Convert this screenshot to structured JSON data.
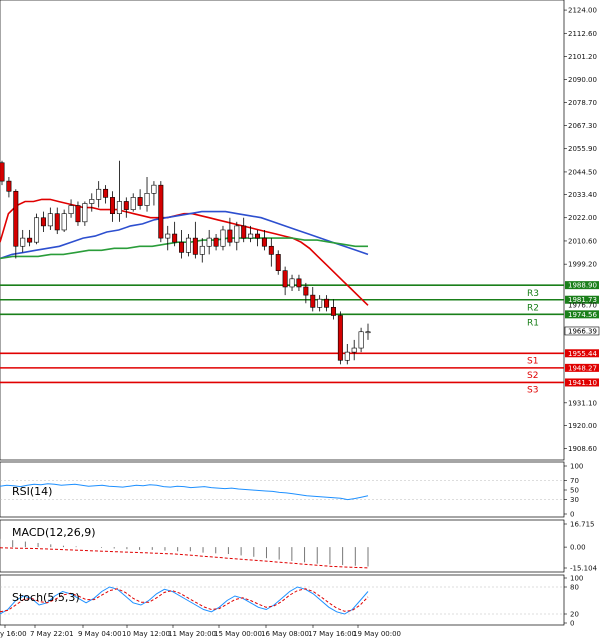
{
  "chart_data": {
    "type": "candlestick",
    "instrument_note": "",
    "price_axis": {
      "ylim": [
        1904.0,
        2126.0
      ],
      "ticks": [
        "2124.00",
        "2112.60",
        "2101.20",
        "2090.00",
        "2078.70",
        "2067.30",
        "2055.90",
        "2044.50",
        "2033.40",
        "2022.00",
        "2010.60",
        "1999.20",
        "1920.00",
        "1908.60",
        "1931.10"
      ],
      "tick_values": [
        2124.0,
        2112.6,
        2101.2,
        2090.0,
        2078.7,
        2067.3,
        2055.9,
        2044.5,
        2033.4,
        2022.0,
        2010.6,
        1999.2,
        1920.0,
        1908.6,
        1931.1
      ]
    },
    "x_labels": [
      "y 16:00",
      "7 May 22:01",
      "9 May 04:00",
      "10 May 12:00",
      "11 May 20:00",
      "15 May 00:00",
      "16 May 08:00",
      "17 May 16:00",
      "19 May 00:00"
    ],
    "candles": [
      [
        2049,
        2050,
        2038,
        2040
      ],
      [
        2040,
        2042,
        2032,
        2035
      ],
      [
        2035,
        2036,
        2002,
        2008
      ],
      [
        2008,
        2016,
        2005,
        2012
      ],
      [
        2012,
        2016,
        2008,
        2010
      ],
      [
        2010,
        2024,
        2009,
        2022
      ],
      [
        2022,
        2025,
        2015,
        2018
      ],
      [
        2018,
        2027,
        2016,
        2024
      ],
      [
        2024,
        2027,
        2014,
        2016
      ],
      [
        2016,
        2026,
        2015,
        2024
      ],
      [
        2024,
        2031,
        2022,
        2028
      ],
      [
        2028,
        2030,
        2018,
        2020
      ],
      [
        2020,
        2030,
        2018,
        2029
      ],
      [
        2029,
        2034,
        2025,
        2031
      ],
      [
        2031,
        2040,
        2027,
        2036
      ],
      [
        2036,
        2038,
        2029,
        2032
      ],
      [
        2032,
        2035,
        2020,
        2024
      ],
      [
        2024,
        2050,
        2020,
        2030
      ],
      [
        2030,
        2032,
        2022,
        2026
      ],
      [
        2026,
        2034,
        2025,
        2032
      ],
      [
        2032,
        2036,
        2026,
        2028
      ],
      [
        2028,
        2042,
        2025,
        2034
      ],
      [
        2034,
        2040,
        2028,
        2038
      ],
      [
        2038,
        2040,
        2010,
        2012
      ],
      [
        2012,
        2018,
        2006,
        2014
      ],
      [
        2014,
        2020,
        2008,
        2010
      ],
      [
        2010,
        2016,
        2002,
        2005
      ],
      [
        2005,
        2014,
        2003,
        2012
      ],
      [
        2012,
        2020,
        2002,
        2004
      ],
      [
        2004,
        2012,
        2000,
        2008
      ],
      [
        2008,
        2016,
        2004,
        2012
      ],
      [
        2012,
        2014,
        2006,
        2008
      ],
      [
        2008,
        2018,
        2006,
        2016
      ],
      [
        2016,
        2022,
        2008,
        2010
      ],
      [
        2010,
        2020,
        2006,
        2018
      ],
      [
        2018,
        2022,
        2010,
        2012
      ],
      [
        2012,
        2018,
        2010,
        2014
      ],
      [
        2014,
        2016,
        2008,
        2012
      ],
      [
        2012,
        2016,
        2006,
        2008
      ],
      [
        2008,
        2012,
        1998,
        2004
      ],
      [
        2004,
        2006,
        1994,
        1996
      ],
      [
        1996,
        1998,
        1984,
        1988
      ],
      [
        1988,
        1994,
        1986,
        1992
      ],
      [
        1992,
        1994,
        1986,
        1988
      ],
      [
        1988,
        1990,
        1980,
        1984
      ],
      [
        1984,
        1988,
        1976,
        1978
      ],
      [
        1978,
        1984,
        1976,
        1982
      ],
      [
        1982,
        1984,
        1976,
        1978
      ],
      [
        1978,
        1982,
        1972,
        1974
      ],
      [
        1974,
        1976,
        1950,
        1952
      ],
      [
        1952,
        1960,
        1950,
        1956
      ],
      [
        1956,
        1962,
        1952,
        1958
      ],
      [
        1958,
        1968,
        1956,
        1966
      ],
      [
        1966,
        1970,
        1962,
        1966
      ]
    ],
    "moving_averages": [
      {
        "color": "#e00000",
        "values": [
          2010,
          2024,
          2028,
          2030,
          2030,
          2031,
          2031,
          2030,
          2029,
          2028,
          2027,
          2027,
          2026,
          2026,
          2026,
          2025,
          2024,
          2023,
          2022,
          2022,
          2022,
          2023,
          2024,
          2024,
          2023,
          2022,
          2021,
          2020,
          2019,
          2018,
          2017,
          2016,
          2015,
          2014,
          2013,
          2012,
          2010,
          2007,
          2003,
          1999,
          1995,
          1991,
          1987,
          1983,
          1979
        ]
      },
      {
        "color": "#2d4fcf",
        "values": [
          2002,
          2004,
          2005,
          2006,
          2007,
          2008,
          2010,
          2012,
          2013,
          2015,
          2016,
          2018,
          2019,
          2021,
          2022,
          2023,
          2024,
          2025,
          2025,
          2025,
          2024,
          2023,
          2022,
          2020,
          2018,
          2016,
          2014,
          2012,
          2010,
          2008,
          2006,
          2004
        ]
      },
      {
        "color": "#2a9d3a",
        "values": [
          2002,
          2003,
          2003,
          2003,
          2004,
          2004,
          2005,
          2006,
          2006,
          2007,
          2007,
          2008,
          2008,
          2009,
          2010,
          2010,
          2011,
          2011,
          2012,
          2012,
          2012,
          2012,
          2012,
          2012,
          2011,
          2011,
          2010,
          2009,
          2008,
          2008
        ]
      }
    ],
    "levels": [
      {
        "name": "R3",
        "value": 1988.9,
        "label": "1988.90",
        "color": "#1a7f1a"
      },
      {
        "name": "R2",
        "value": 1981.73,
        "label": "1981.73",
        "color": "#1a7f1a"
      },
      {
        "name": "R1",
        "value": 1974.56,
        "label": "1974.56",
        "color": "#1a7f1a"
      },
      {
        "name": "S1",
        "value": 1955.44,
        "label": "1955.44",
        "color": "#e00000"
      },
      {
        "name": "S2",
        "value": 1948.27,
        "label": "1948.27",
        "color": "#e00000"
      },
      {
        "name": "S3",
        "value": 1941.1,
        "label": "1941.10",
        "color": "#e00000"
      }
    ],
    "current_price": {
      "value": 1966.39,
      "label": "1966.39"
    },
    "hidden_label": "1976.70",
    "rsi": {
      "title": "RSI(14)",
      "ticks": [
        "100",
        "70",
        "50",
        "30",
        "0"
      ],
      "tick_values": [
        100,
        70,
        50,
        30,
        0
      ],
      "color": "#1e90ff",
      "values": [
        58,
        60,
        59,
        57,
        60,
        62,
        61,
        63,
        62,
        60,
        61,
        62,
        60,
        58,
        59,
        60,
        58,
        57,
        56,
        58,
        60,
        59,
        61,
        60,
        57,
        56,
        58,
        57,
        55,
        56,
        57,
        55,
        54,
        53,
        54,
        52,
        51,
        50,
        49,
        48,
        47,
        45,
        44,
        42,
        40,
        38,
        37,
        36,
        35,
        34,
        33,
        30,
        32,
        35,
        38
      ]
    },
    "macd": {
      "title": "MACD(12,26,9)",
      "ticks": [
        "16.715",
        "0.00",
        "-15.104"
      ],
      "tick_values": [
        16.715,
        0.0,
        -15.104
      ],
      "hist": [
        6,
        5,
        4,
        3,
        2,
        1,
        0.5,
        0,
        -0.5,
        -1,
        -1.5,
        -2,
        -2,
        -2.5,
        -3,
        -3,
        -4,
        -4.5,
        -5,
        -6,
        -7,
        -8,
        -9,
        -10,
        -11,
        -12,
        -12.5,
        -13,
        -13.5,
        -14
      ],
      "signal_color": "#e00000",
      "signal": [
        -0.5,
        -0.8,
        -1.0,
        -1.5,
        -2,
        -2.5,
        -3,
        -3.5,
        -4,
        -4.5,
        -5,
        -6,
        -7,
        -8,
        -9,
        -10,
        -11,
        -12,
        -13,
        -14,
        -14.5,
        -15
      ]
    },
    "stoch": {
      "title": "Stoch(5,5,3)",
      "ticks": [
        "100",
        "80",
        "20",
        "0"
      ],
      "tick_values": [
        100,
        80,
        20,
        0
      ],
      "main_color": "#1e90ff",
      "signal_color": "#e00000",
      "main": [
        20,
        30,
        50,
        60,
        55,
        40,
        45,
        60,
        70,
        65,
        55,
        45,
        55,
        70,
        80,
        75,
        60,
        45,
        40,
        50,
        65,
        75,
        70,
        60,
        50,
        40,
        30,
        25,
        35,
        50,
        60,
        55,
        45,
        35,
        30,
        40,
        55,
        70,
        80,
        75,
        65,
        50,
        35,
        25,
        20,
        30,
        50,
        70
      ],
      "signal": [
        25,
        28,
        40,
        52,
        55,
        48,
        45,
        52,
        62,
        66,
        60,
        52,
        52,
        62,
        72,
        76,
        68,
        55,
        46,
        46,
        56,
        68,
        72,
        66,
        56,
        46,
        36,
        30,
        32,
        42,
        52,
        56,
        50,
        42,
        35,
        38,
        48,
        62,
        72,
        76,
        70,
        58,
        45,
        33,
        26,
        28,
        40,
        58
      ]
    }
  }
}
